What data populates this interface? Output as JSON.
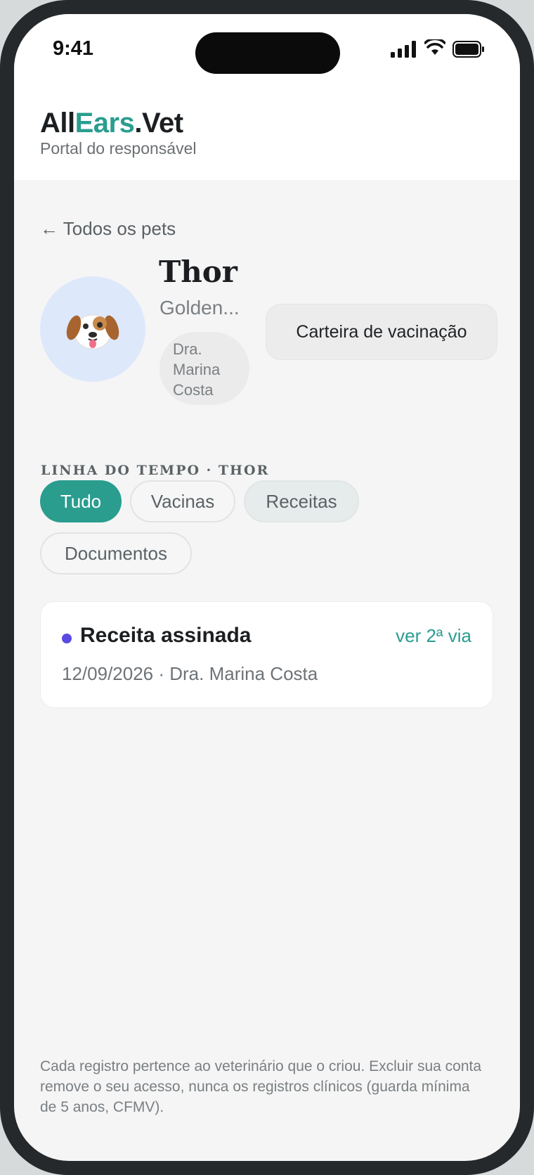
{
  "status_bar": {
    "time": "9:41"
  },
  "header": {
    "brand_part1": "All",
    "brand_part2": "Ears",
    "brand_part3": ".Vet",
    "subtitle": "Portal do responsável"
  },
  "nav": {
    "back_label": "← Todos os pets"
  },
  "pet": {
    "name": "Thor",
    "breed": "Golden...",
    "vet": "Dra. Marina Costa",
    "avatar_icon": "dog-face-icon",
    "vaccination_button": "Carteira de vacinação"
  },
  "timeline": {
    "title": "LINHA DO TEMPO · THOR",
    "filters": [
      "Tudo",
      "Vacinas",
      "Receitas",
      "Documentos"
    ],
    "active_filter": "Tudo",
    "entries": [
      {
        "title": "Receita assinada",
        "action": "ver 2ª via",
        "date": "12/09/2026",
        "separator": " · ",
        "vet": "Dra. Marina Costa",
        "dot_color": "#5a4ae3"
      }
    ]
  },
  "footer": {
    "note": "Cada registro pertence ao veterinário que o criou. Excluir sua conta remove o seu acesso, nunca os registros clínicos (guarda mínima de 5 anos, CFMV)."
  },
  "colors": {
    "accent": "#2a9d8f",
    "avatar_bg": "#dde8fb"
  }
}
